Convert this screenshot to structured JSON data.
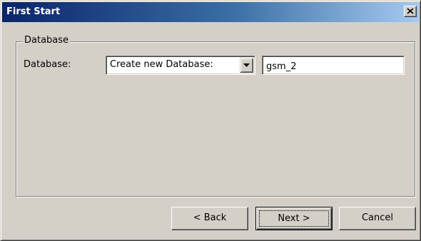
{
  "window": {
    "title": "First Start"
  },
  "titlebar_buttons": {
    "close_icon": "close-x-icon"
  },
  "group": {
    "legend": "Database",
    "field_label": "Database:",
    "combo": {
      "selected": "Create new Database:",
      "arrow_icon": "chevron-down-icon"
    },
    "input": {
      "value": "gsm_2"
    }
  },
  "buttons": {
    "back": "< Back",
    "next": "Next >",
    "cancel": "Cancel"
  },
  "colors": {
    "face": "#d4d0c8",
    "title_start": "#0a246a",
    "title_end": "#a6caf0"
  }
}
